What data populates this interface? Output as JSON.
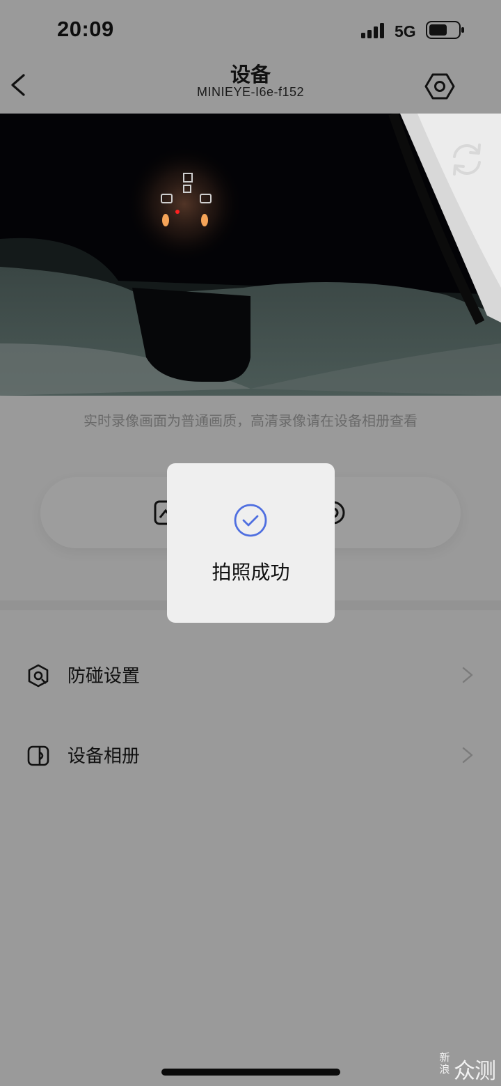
{
  "status_bar": {
    "time": "20:09",
    "network": "5G"
  },
  "nav": {
    "title": "设备",
    "subtitle": "MINIEYE-I6e-f152"
  },
  "icons": {
    "back": "back-arrow-icon",
    "settings": "hexagon-gear-icon",
    "refresh": "refresh-icon",
    "success": "check-circle-icon",
    "collision": "shield-gear-icon",
    "album": "album-icon"
  },
  "live_hint": "实时录像画面为普通画质，高清录像请在设备相册查看",
  "menu": {
    "items": [
      {
        "label": "防碰设置"
      },
      {
        "label": "设备相册"
      }
    ]
  },
  "toast": {
    "message": "拍照成功"
  },
  "watermark": {
    "small": "新浪",
    "large": "众测"
  },
  "colors": {
    "overlay_background": "#9a9a9a",
    "toast_background": "#efefef",
    "success_accent": "#4f6fe0",
    "video_background": "#030306"
  }
}
